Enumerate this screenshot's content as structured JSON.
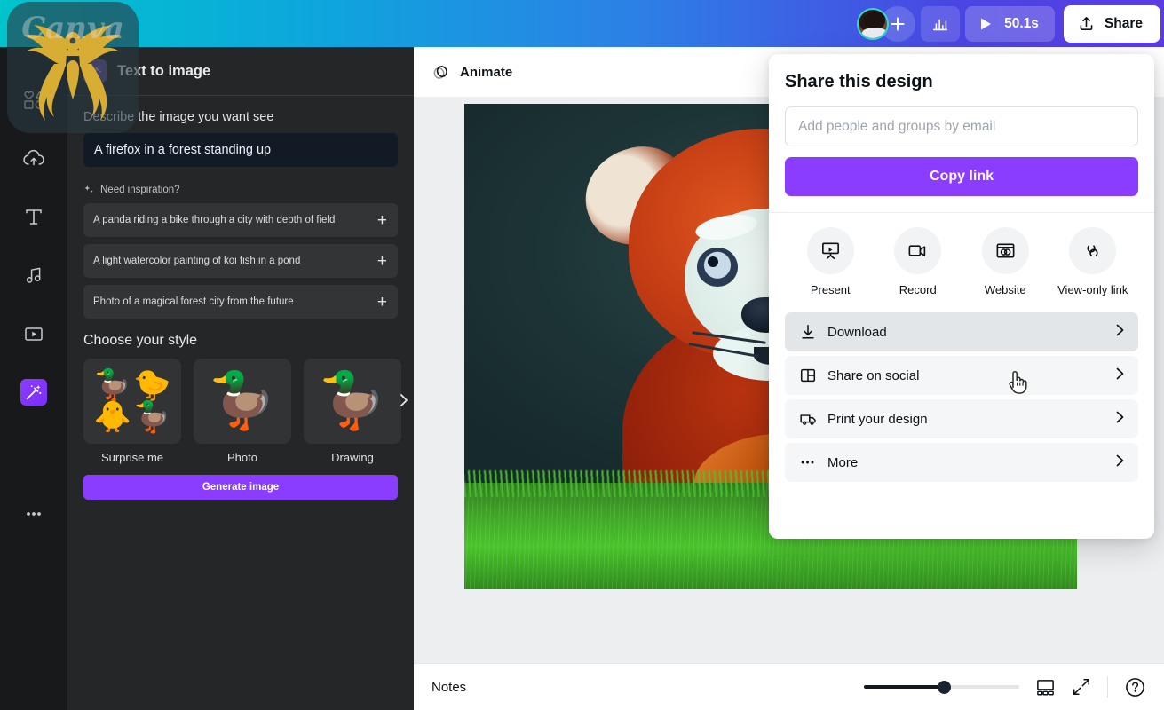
{
  "topbar": {
    "plus_icon": "plus-icon",
    "stats_icon": "bar-chart-icon",
    "play_icon": "play-icon",
    "duration": "50.1s",
    "share_label": "Share",
    "share_icon": "upload-icon",
    "avatar_icon": "user-avatar"
  },
  "rail": {
    "items": [
      {
        "name": "elements",
        "icon": "shapes-icon"
      },
      {
        "name": "uploads",
        "icon": "cloud-upload-icon"
      },
      {
        "name": "text",
        "icon": "text-t-icon"
      },
      {
        "name": "audio",
        "icon": "music-note-icon"
      },
      {
        "name": "videos",
        "icon": "video-play-icon"
      },
      {
        "name": "apps",
        "icon": "magic-app-icon"
      },
      {
        "name": "more",
        "icon": "ellipsis-icon"
      }
    ]
  },
  "panel": {
    "title": "Text to image",
    "app_icon": "magic-media-icon",
    "describe_label": "Describe the image you want see",
    "prompt_value": "A firefox in a forest standing up",
    "prompt_placeholder": "Describe the image you want see",
    "inspiration_label": "Need inspiration?",
    "inspiration_icon": "sparkle-icon",
    "suggestions": [
      "A panda riding a bike through a city with depth of field",
      "A light watercolor painting of koi fish in a pond",
      "Photo of a magical forest city from the future"
    ],
    "style_title": "Choose your style",
    "styles": [
      {
        "label": "Surprise me",
        "icon": "duck-grid-thumb"
      },
      {
        "label": "Photo",
        "icon": "duck-photo-thumb"
      },
      {
        "label": "Drawing",
        "icon": "duck-drawing-thumb"
      }
    ],
    "style_next_icon": "chevron-right-icon",
    "generate_label": "Generate image"
  },
  "editor": {
    "animate_label": "Animate",
    "animate_icon": "animate-circles-icon",
    "canvas_alt": "Generated red panda standing in grass"
  },
  "bottombar": {
    "notes_label": "Notes",
    "zoom_percent": 52,
    "grid_icon": "pages-grid-icon",
    "fullscreen_icon": "expand-arrows-icon",
    "help_icon": "help-question-icon"
  },
  "share": {
    "title": "Share this design",
    "email_placeholder": "Add people and groups by email",
    "email_value": "",
    "copy_link_label": "Copy link",
    "quick_actions": [
      {
        "label": "Present",
        "icon": "present-screen-icon"
      },
      {
        "label": "Record",
        "icon": "record-camera-icon"
      },
      {
        "label": "Website",
        "icon": "website-window-icon"
      },
      {
        "label": "View-only link",
        "icon": "link-chain-icon"
      }
    ],
    "menu_items": [
      {
        "label": "Download",
        "icon": "download-arrow-icon",
        "hovered": true
      },
      {
        "label": "Share on social",
        "icon": "social-panels-icon",
        "hovered": false
      },
      {
        "label": "Print your design",
        "icon": "print-truck-icon",
        "hovered": false
      },
      {
        "label": "More",
        "icon": "ellipsis-icon",
        "hovered": false
      }
    ],
    "chevron_icon": "chevron-right-icon"
  },
  "watermark": {
    "text": "Canva",
    "icon": "phoenix-logo"
  },
  "colors": {
    "brand_purple": "#8b3dff",
    "topbar_cyan": "#00c4cc",
    "topbar_blue": "#4a46e3",
    "panel_bg": "#252627",
    "rail_bg": "#18191b"
  }
}
